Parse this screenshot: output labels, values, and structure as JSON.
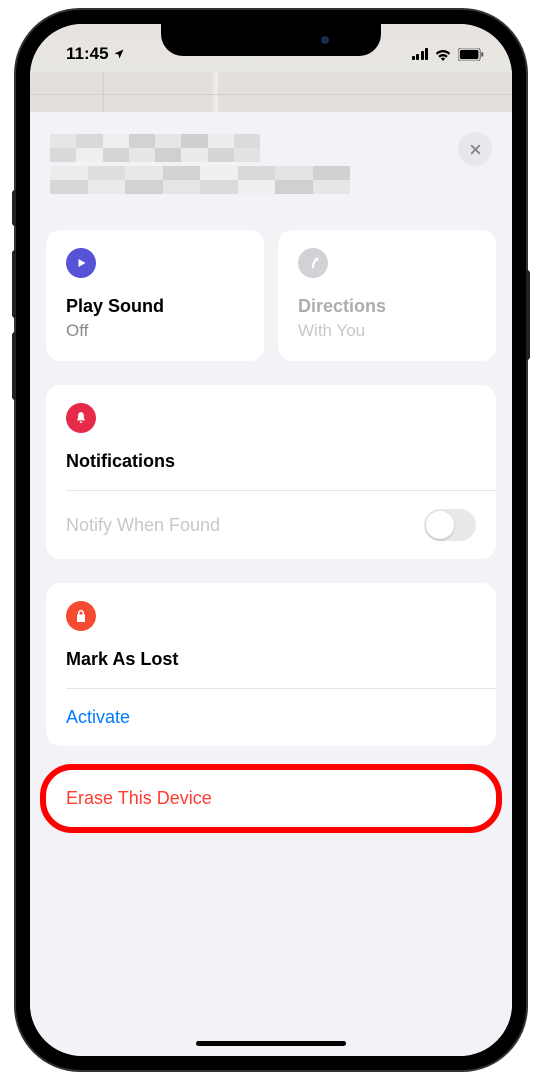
{
  "statusbar": {
    "time": "11:45"
  },
  "actions": {
    "play_sound": {
      "title": "Play Sound",
      "status": "Off"
    },
    "directions": {
      "title": "Directions",
      "status": "With You"
    }
  },
  "notifications": {
    "title": "Notifications",
    "notify_row": "Notify When Found"
  },
  "mark_lost": {
    "title": "Mark As Lost",
    "action": "Activate"
  },
  "erase": {
    "label": "Erase This Device"
  }
}
